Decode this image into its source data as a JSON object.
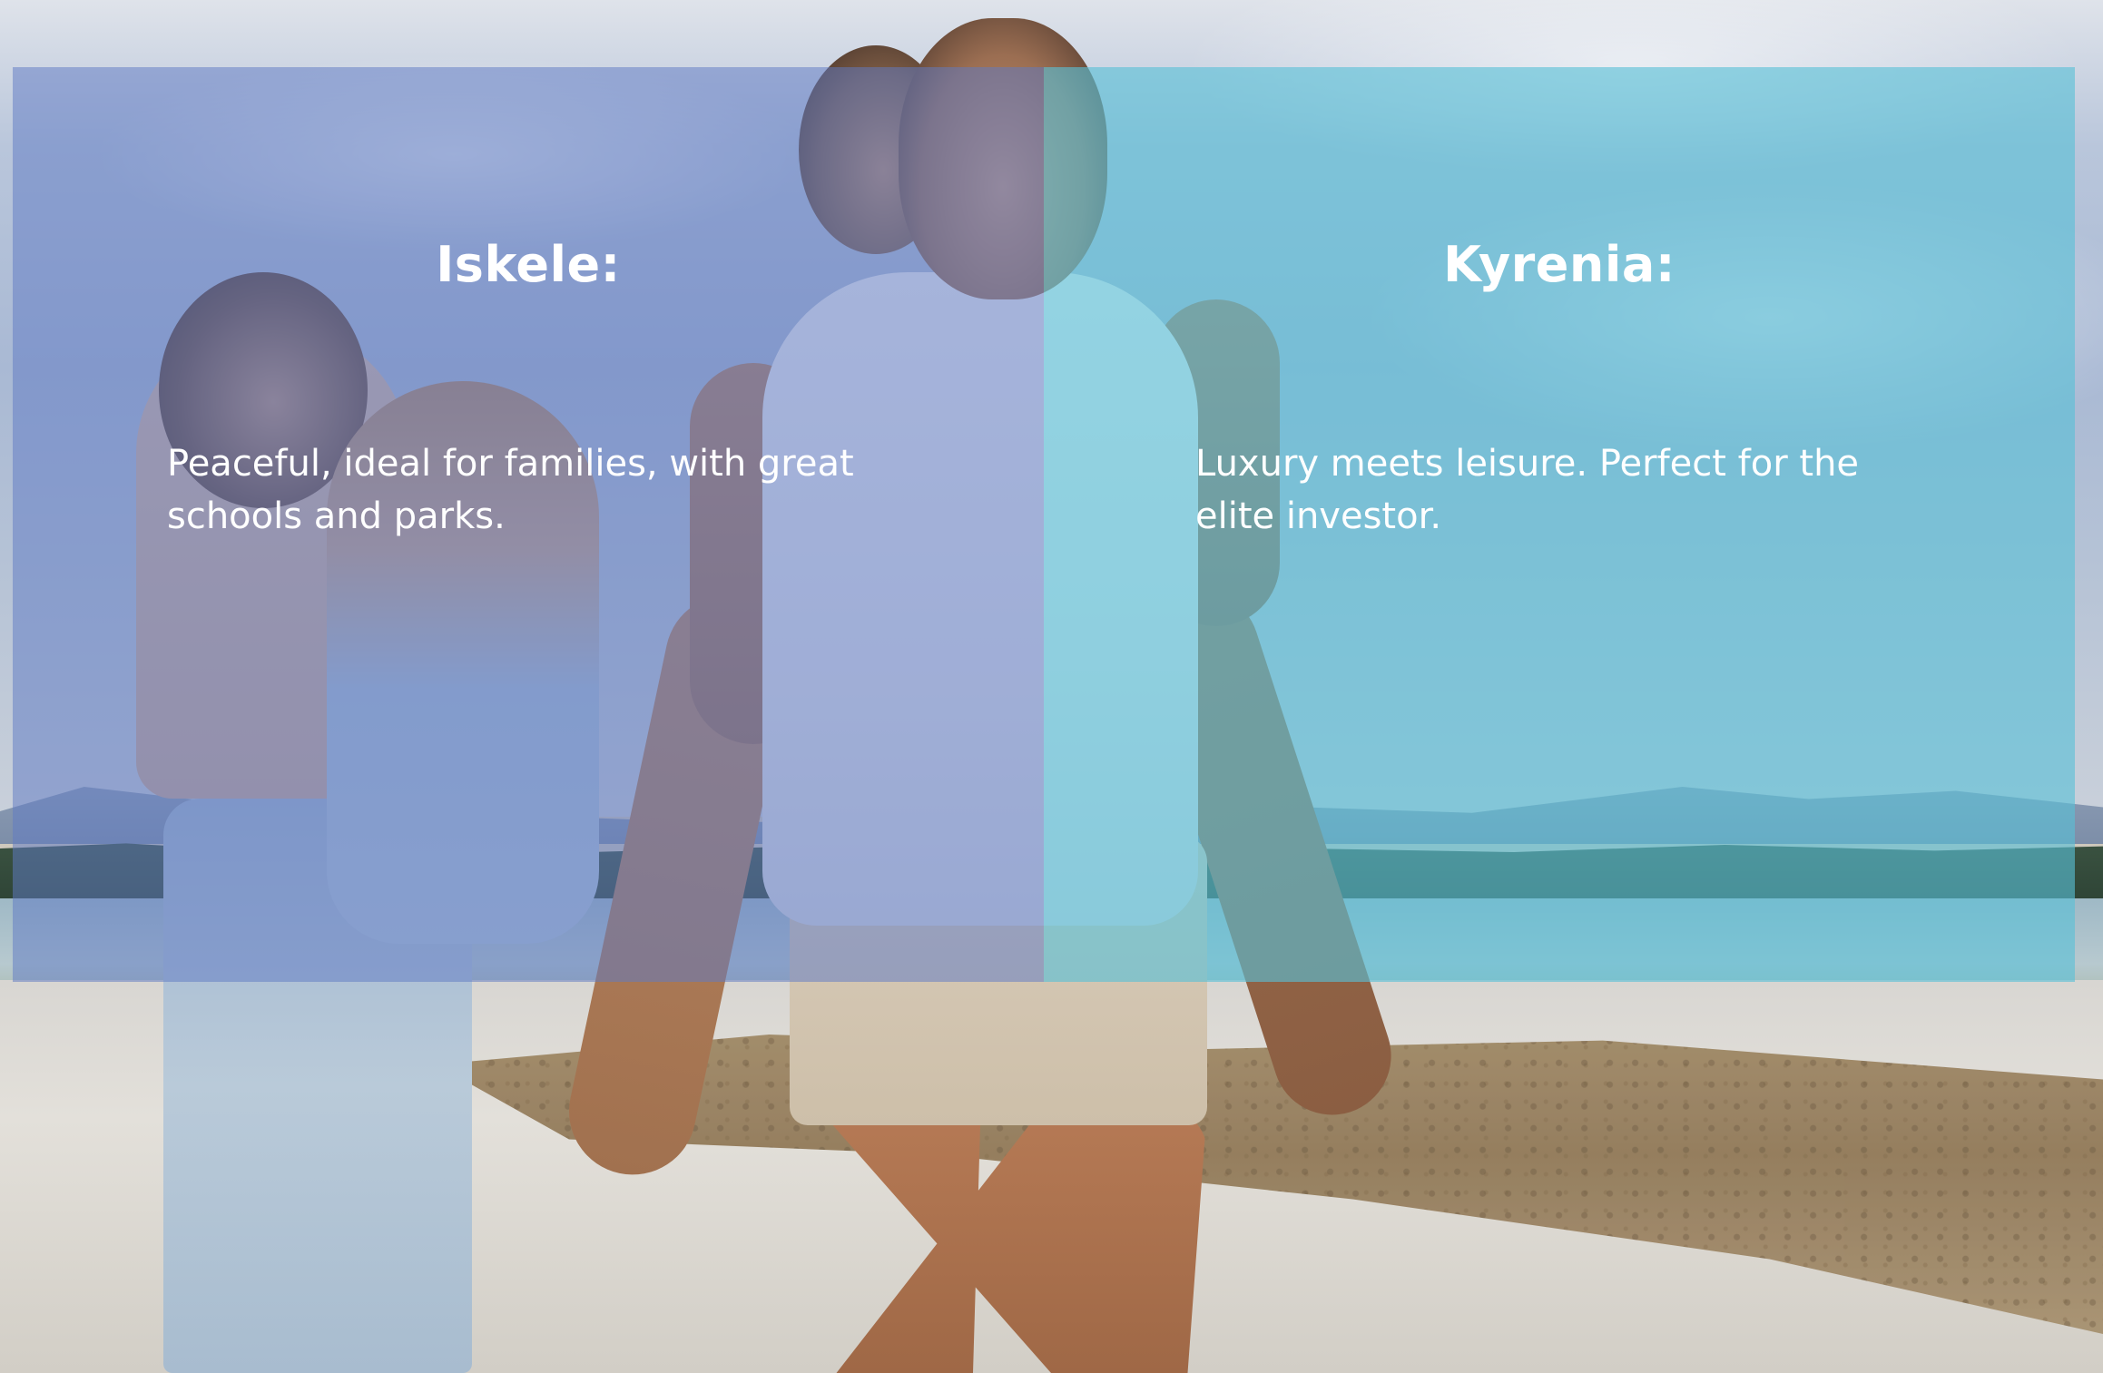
{
  "background": {
    "icon": "family-beach-photo"
  },
  "panels": [
    {
      "title": "Iskele:",
      "text": "Peaceful, ideal for families, with great schools and parks.",
      "color": "#607ac4"
    },
    {
      "title": "Kyrenia:",
      "text": "Luxury meets leisure. Perfect for the elite investor.",
      "color": "#58c0d6"
    }
  ]
}
